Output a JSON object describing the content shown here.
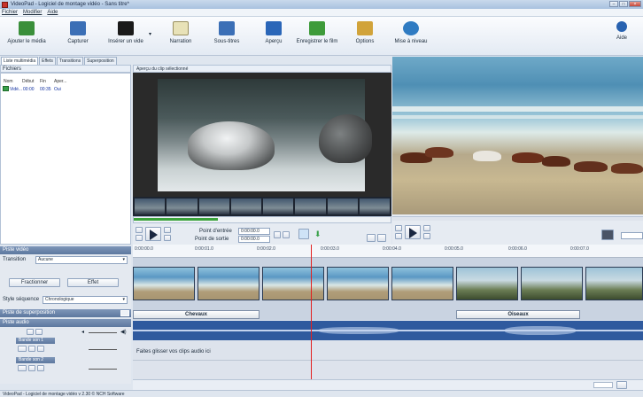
{
  "window": {
    "title": "VideoPad - Logiciel de montage vidéo - Sans titre*"
  },
  "menu": [
    "Fichier",
    "Modifier",
    "Aide"
  ],
  "toolbar": [
    {
      "label": "Ajouter le média",
      "icon": "add-media-icon",
      "color": "#3a8f3a"
    },
    {
      "label": "Capturer",
      "icon": "capture-icon",
      "color": "#3b6fb6"
    },
    {
      "label": "Insérer un vide",
      "icon": "blank-clip-icon",
      "color": "#1a1a1a"
    },
    {
      "label": "Narration",
      "icon": "narration-icon",
      "color": "#e8e2b8"
    },
    {
      "label": "Sous-titres",
      "icon": "subtitles-icon",
      "color": "#3b6fb6"
    },
    {
      "label": "Aperçu",
      "icon": "preview-icon",
      "color": "#2a66b8"
    },
    {
      "label": "Enregistrer le film",
      "icon": "save-movie-icon",
      "color": "#3e9b3a"
    },
    {
      "label": "Options",
      "icon": "options-icon",
      "color": "#d1a33a"
    },
    {
      "label": "Mise à niveau",
      "icon": "upgrade-icon",
      "color": "#2f7bc2"
    },
    {
      "label": "Aide",
      "icon": "help-icon",
      "color": "#2862b0"
    }
  ],
  "left_tabs": [
    "Liste multimédia",
    "Effets",
    "Transitions",
    "Superposition"
  ],
  "folders_label": "Fichiers",
  "media_columns": [
    "Nom",
    "Début",
    "Fin",
    "Aper..."
  ],
  "media_row": {
    "name": "Vidé...",
    "start": "00:00",
    "end": "00:35",
    "preview": "Oui"
  },
  "clip_preview": {
    "header": "Aperçu du clip sélectionné",
    "in_label": "Point d'entrée",
    "in_value": "0:00:00.0",
    "out_label": "Point de sortie",
    "out_value": "0:00:00.0"
  },
  "video_track": {
    "header": "Piste vidéo",
    "transition_label": "Transition",
    "transition_value": "Aucune",
    "fragment_button": "Fractionner",
    "effect_button": "Effet",
    "sequence_label": "Style séquence",
    "sequence_value": "Chronologique"
  },
  "overlay_header": "Piste de superposition",
  "audio": {
    "header": "Piste audio",
    "track1": "Bande son 1",
    "track2": "Bande son 2",
    "drop_hint": "Faites glisser vos clips audio ici"
  },
  "timeline": {
    "ticks": [
      "0:00:00.0",
      "0:00:01.0",
      "0:00:02.0",
      "0:00:03.0",
      "0:00:04.0",
      "0:00:05.0",
      "0:00:06.0",
      "0:00:07.0"
    ],
    "title_clips": [
      "Chevaux",
      "Oiseaux"
    ]
  },
  "status": "VideoPad - Logiciel de montage vidéo v 2.30 © NCH Software"
}
